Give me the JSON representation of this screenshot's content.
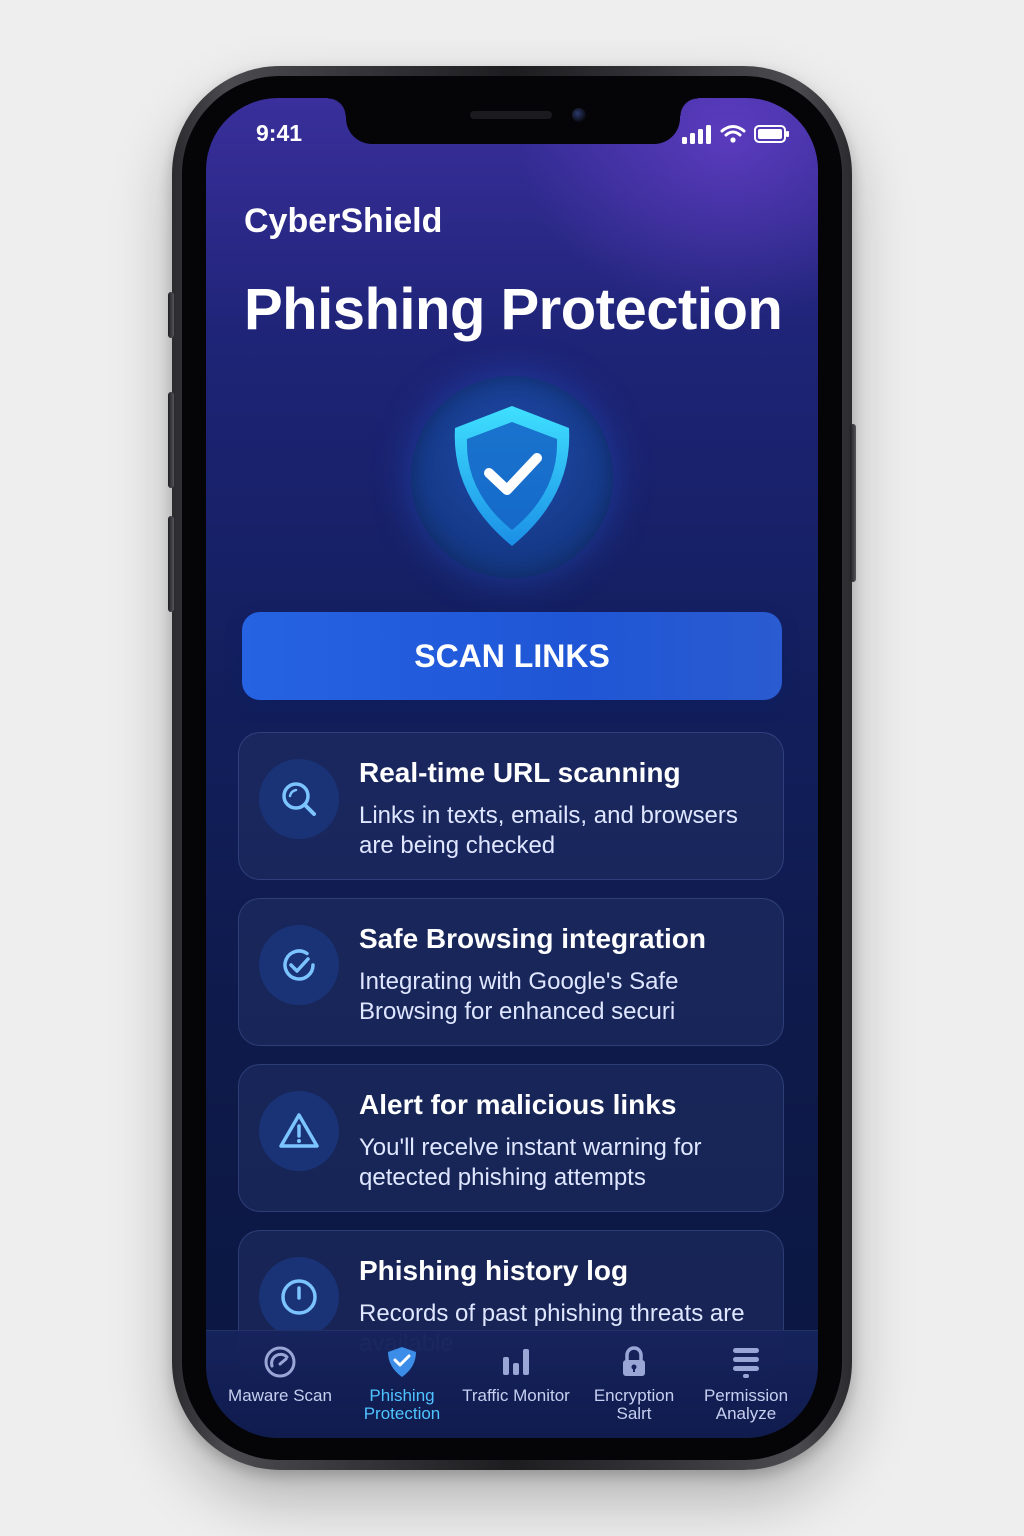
{
  "status_bar": {
    "time": "9:41"
  },
  "header": {
    "app_name": "CyberShield",
    "title": "Phishing Protection"
  },
  "hero_icon": "shield-check-icon",
  "scan_button": {
    "label": "SCAN LINKS"
  },
  "features": [
    {
      "icon": "search-icon",
      "title": "Real-time URL scanning",
      "description": "Links in texts, emails, and browsers are being checked"
    },
    {
      "icon": "check-circle-icon",
      "title": "Safe Browsing integration",
      "description": "Integrating with Google's Safe Browsing for enhanced securi"
    },
    {
      "icon": "warning-triangle-icon",
      "title": "Alert for malicious links",
      "description": "You'll recelve instant warning for qetected phishing attempts"
    },
    {
      "icon": "clock-icon",
      "title": "Phishing history log",
      "description": "Records of past phishing threats are available"
    }
  ],
  "tabs": [
    {
      "label": "Maware Scan",
      "icon": "gauge-icon",
      "active": false
    },
    {
      "label": "Phishing Protection",
      "icon": "shield-check-icon",
      "active": true
    },
    {
      "label": "Traffic Monitor",
      "icon": "bar-chart-icon",
      "active": false
    },
    {
      "label": "Encryption Salrt",
      "icon": "lock-icon",
      "active": false
    },
    {
      "label": "Permission Analyze",
      "icon": "list-icon",
      "active": false
    }
  ],
  "colors": {
    "accent": "#2563e3",
    "active_tab": "#4fc3ff",
    "background": "#131f5e"
  }
}
